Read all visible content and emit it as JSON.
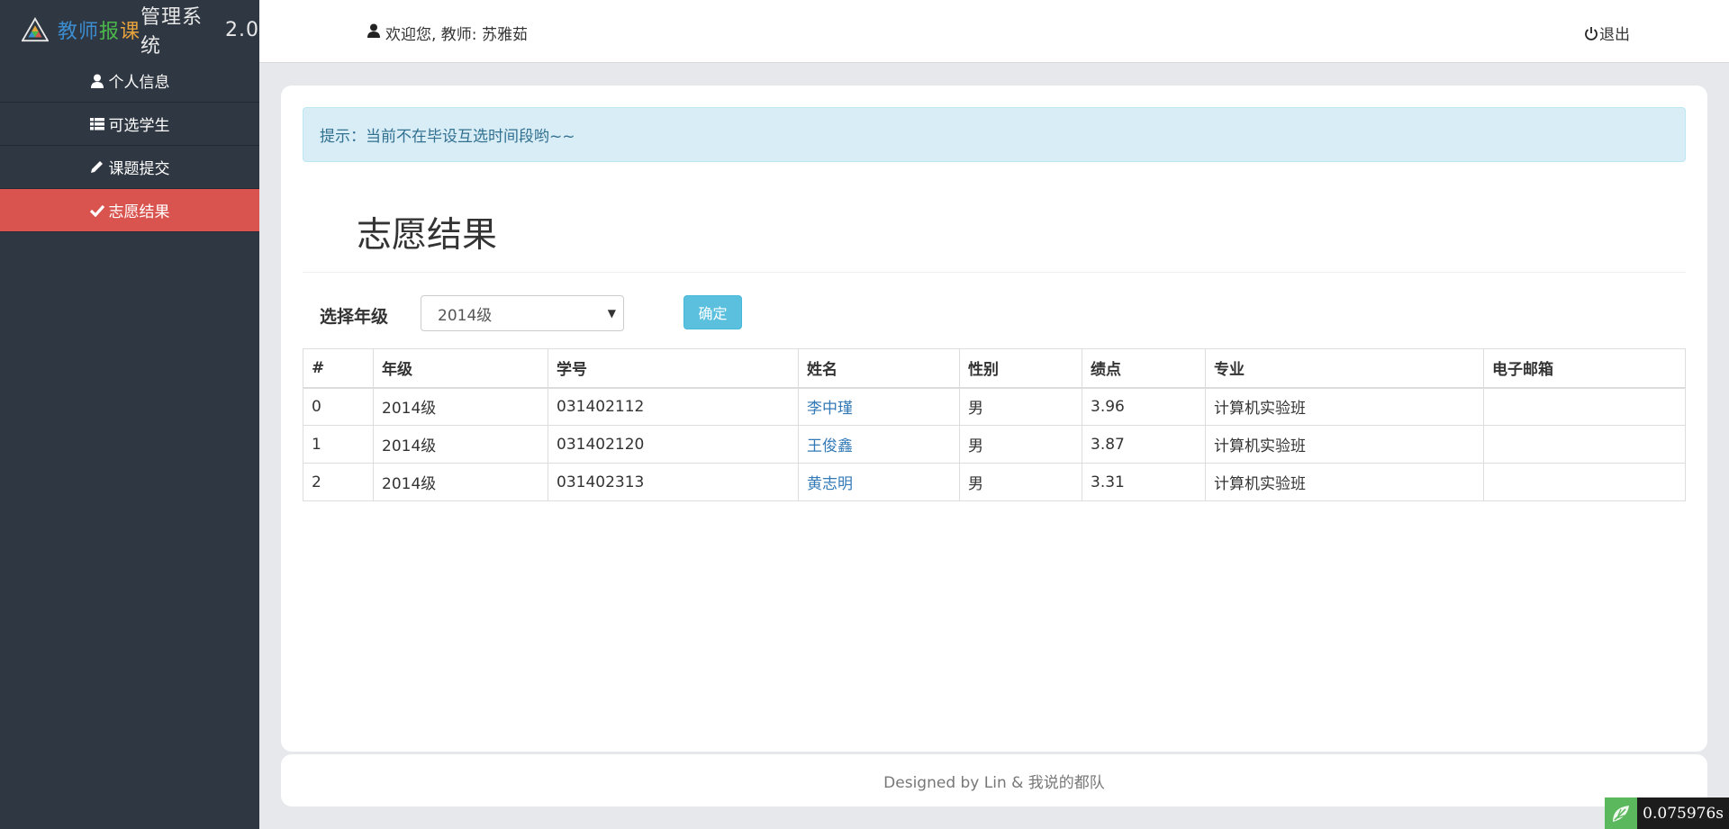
{
  "brand": {
    "part1": "教",
    "part2": "师",
    "part3": "报",
    "part4": "课",
    "rest": "管理系统",
    "version": "2.0"
  },
  "sidebar": {
    "items": [
      {
        "label": "个人信息",
        "icon": "user-icon",
        "active": false
      },
      {
        "label": "可选学生",
        "icon": "list-icon",
        "active": false
      },
      {
        "label": "课题提交",
        "icon": "pencil-icon",
        "active": false
      },
      {
        "label": "志愿结果",
        "icon": "check-icon",
        "active": true
      }
    ]
  },
  "header": {
    "welcome": "欢迎您, 教师: 苏雅茹",
    "logout": "退出"
  },
  "alert": {
    "text": "提示：当前不在毕设互选时间段哟~~"
  },
  "main": {
    "title": "志愿结果",
    "grade_label": "选择年级",
    "grade_selected": "2014级",
    "confirm": "确定"
  },
  "table": {
    "headers": [
      "#",
      "年级",
      "学号",
      "姓名",
      "性别",
      "绩点",
      "专业",
      "电子邮箱"
    ],
    "rows": [
      [
        "0",
        "2014级",
        "031402112",
        "李中瑾",
        "男",
        "3.96",
        "计算机实验班",
        ""
      ],
      [
        "1",
        "2014级",
        "031402120",
        "王俊鑫",
        "男",
        "3.87",
        "计算机实验班",
        ""
      ],
      [
        "2",
        "2014级",
        "031402313",
        "黄志明",
        "男",
        "3.31",
        "计算机实验班",
        ""
      ]
    ]
  },
  "footer": {
    "text": "Designed by Lin & 我说的都队"
  },
  "timing": "0.075976s",
  "colors": {
    "sidebar_bg": "#2f3742",
    "active_item": "#d9534f",
    "alert_bg": "#d9edf7",
    "button_info": "#5bc0de",
    "link": "#337ab7"
  }
}
